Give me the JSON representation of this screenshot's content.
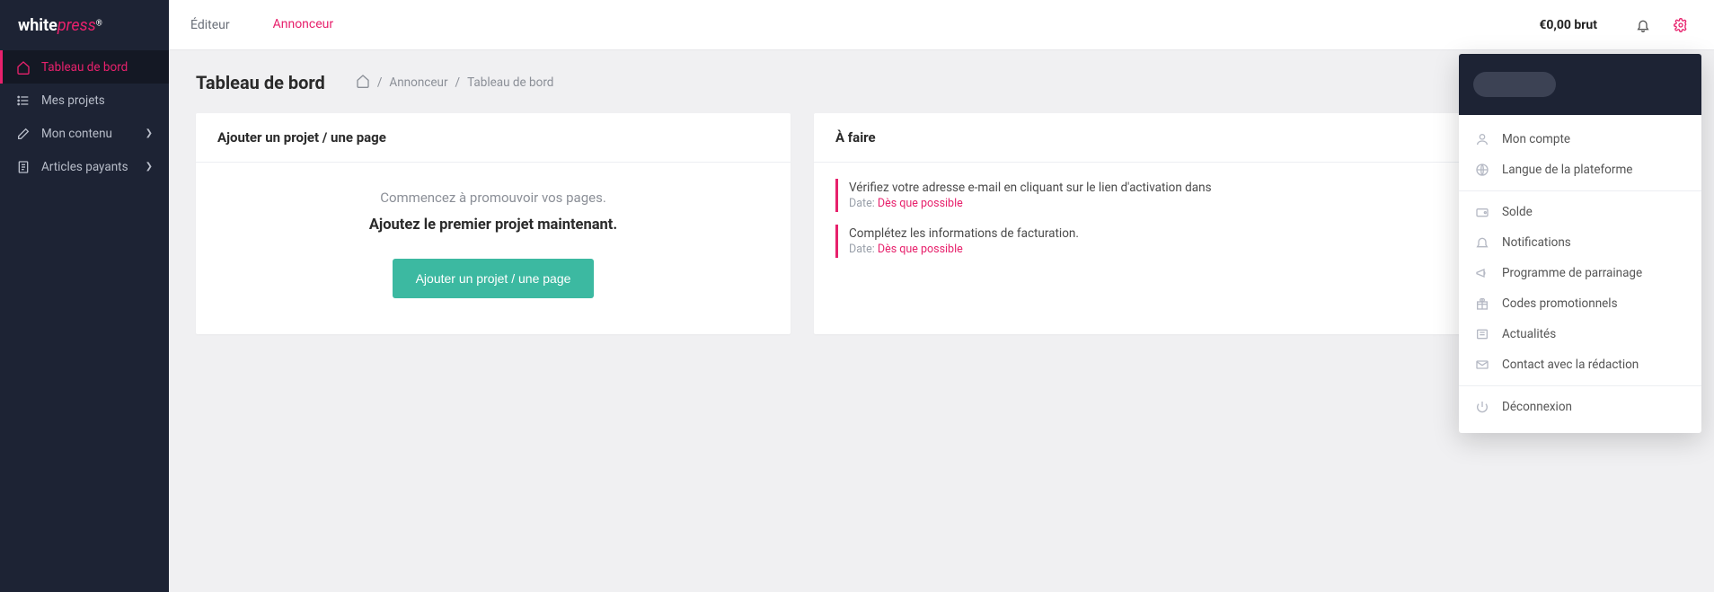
{
  "brand": {
    "part1": "white",
    "part2": "press",
    "reg": "®"
  },
  "sidebar": {
    "items": [
      {
        "label": "Tableau de bord"
      },
      {
        "label": "Mes projets"
      },
      {
        "label": "Mon contenu"
      },
      {
        "label": "Articles payants"
      }
    ]
  },
  "header": {
    "tabs": [
      {
        "label": "Éditeur"
      },
      {
        "label": "Annonceur"
      }
    ],
    "balance": "€0,00 brut"
  },
  "page": {
    "title": "Tableau de bord",
    "breadcrumb": {
      "section": "Annonceur",
      "page": "Tableau de bord",
      "sep": "/"
    }
  },
  "panel_left": {
    "title": "Ajouter un projet / une page",
    "sub": "Commencez à promouvoir vos pages.",
    "main": "Ajoutez le premier projet maintenant.",
    "button": "Ajouter un projet / une page"
  },
  "panel_right": {
    "title": "À faire",
    "items": [
      {
        "text": "Vérifiez votre adresse e-mail en cliquant sur le lien d'activation dans",
        "date_label": "Date:",
        "date_value": "Dès que possible"
      },
      {
        "text": "Complétez les informations de facturation.",
        "date_label": "Date:",
        "date_value": "Dès que possible"
      }
    ]
  },
  "dropdown": {
    "items": [
      {
        "label": "Mon compte"
      },
      {
        "label": "Langue de la plateforme"
      },
      {
        "label": "Solde"
      },
      {
        "label": "Notifications"
      },
      {
        "label": "Programme de parrainage"
      },
      {
        "label": "Codes promotionnels"
      },
      {
        "label": "Actualités"
      },
      {
        "label": "Contact avec la rédaction"
      },
      {
        "label": "Déconnexion"
      }
    ]
  }
}
